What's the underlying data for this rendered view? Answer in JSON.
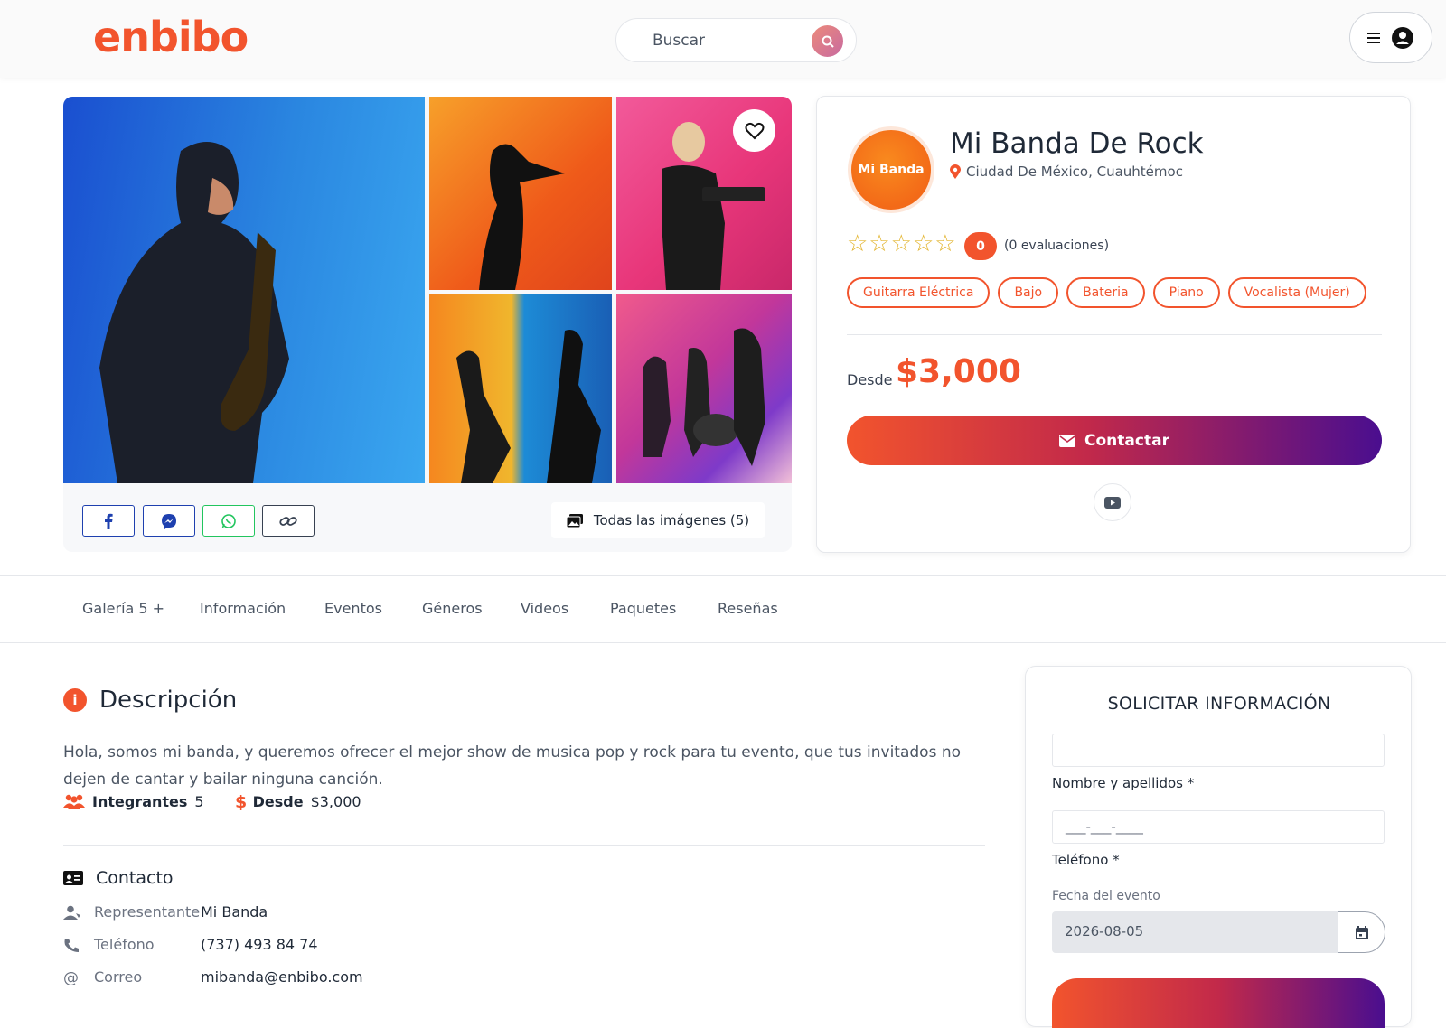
{
  "header": {
    "logo": "enbibo",
    "search_placeholder": "Buscar"
  },
  "gallery": {
    "all_images_label": "Todas las imágenes (5)"
  },
  "profile": {
    "avatar_text": "Mi Banda",
    "name": "Mi Banda De Rock",
    "location": "Ciudad De México, Cuauhtémoc",
    "rating": "0",
    "reviews": "(0 evaluaciones)",
    "tags": [
      "Guitarra Eléctrica",
      "Bajo",
      "Bateria",
      "Piano",
      "Vocalista (Mujer)"
    ],
    "price_prefix": "Desde",
    "price": "$3,000",
    "contact_label": "Contactar"
  },
  "tabs": [
    "Galería 5 +",
    "Información",
    "Eventos",
    "Géneros",
    "Videos",
    "Paquetes",
    "Reseñas"
  ],
  "description": {
    "title": "Descripción",
    "text": "Hola, somos mi banda, y queremos ofrecer el mejor show de musica pop y rock para tu evento, que tus invitados no dejen de cantar y bailar ninguna canción.",
    "members_label": "Integrantes",
    "members_value": "5",
    "from_label": "Desde",
    "from_value": "$3,000"
  },
  "contact": {
    "title": "Contacto",
    "rows": [
      {
        "label": "Representante",
        "value": "Mi Banda"
      },
      {
        "label": "Teléfono",
        "value": "(737) 493 84 74"
      },
      {
        "label": "Correo",
        "value": "mibanda@enbibo.com"
      }
    ]
  },
  "form": {
    "title": "SOLICITAR INFORMACIÓN",
    "name_label": "Nombre y apellidos *",
    "phone_label": "Teléfono *",
    "phone_placeholder": "___-___-____",
    "date_label": "Fecha del evento",
    "date_value": "2026-08-05"
  },
  "colors": {
    "brand": "#f2542d",
    "gradient_end": "#4a0e8f",
    "star": "#e3b530"
  }
}
